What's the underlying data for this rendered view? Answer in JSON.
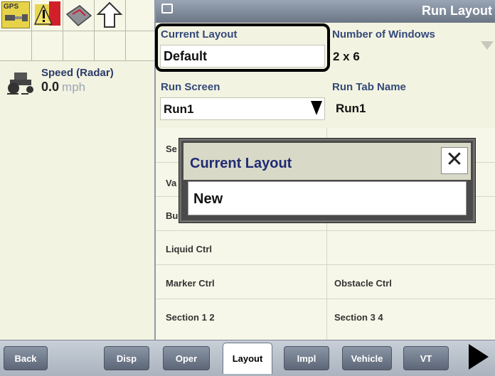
{
  "status_icons": {
    "gps_label": "GPS",
    "icons": [
      "gps-satellite-icon",
      "alarm-warning-icon",
      "implement-icon",
      "arrow-up-icon"
    ]
  },
  "speed": {
    "label": "Speed (Radar)",
    "value": "0.0",
    "unit": "mph",
    "icon": "tractor-icon"
  },
  "header": {
    "title": "Run Layout",
    "icon": "layout-icon"
  },
  "fields": {
    "current_layout_label": "Current Layout",
    "current_layout_value": "Default",
    "num_windows_label": "Number of Windows",
    "num_windows_value": "2 x 6",
    "run_screen_label": "Run Screen",
    "run_screen_value": "Run1",
    "run_tab_label": "Run Tab Name",
    "run_tab_value": "Run1"
  },
  "grid_cells": {
    "r1c1": "Se",
    "r2c1": "Va",
    "r3c1": "Bu",
    "r4c1": "Liquid Ctrl",
    "r5c1": "Marker Ctrl",
    "r5c2": "Obstacle Ctrl",
    "r6c1": "Section 1 2",
    "r6c2": "Section 3 4"
  },
  "dialog": {
    "title": "Current Layout",
    "close": "✕",
    "value": "New"
  },
  "tabs": [
    "Back",
    "Disp",
    "Oper",
    "Layout",
    "Impl",
    "Vehicle",
    "VT"
  ],
  "colors": {
    "highlight": "#000000",
    "header": "#7f8a9a",
    "label": "#33497a"
  }
}
